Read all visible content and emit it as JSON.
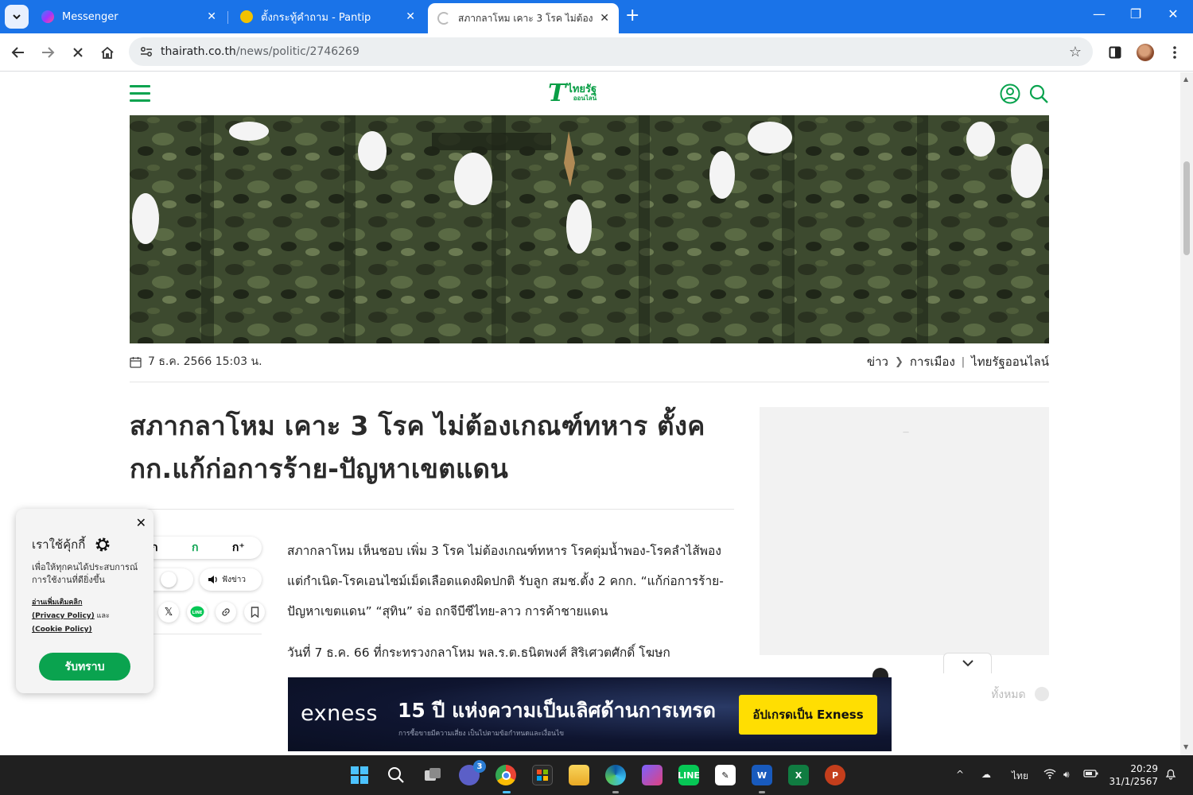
{
  "browser": {
    "tabs": [
      {
        "title": "Messenger",
        "favicon_color": "#a033ff"
      },
      {
        "title": "ตั้งกระทู้คำถาม - Pantip",
        "favicon_color": "#f2c200"
      },
      {
        "title": "สภากลาโหม เคาะ 3 โรค ไม่ต้องเกณฑ์ทหาร ตั้งค กก.แก้ก่อการร้าย-ปัญหาเขตแดน",
        "favicon_color": "#bbbbbb",
        "active": true
      }
    ],
    "close_glyph": "✕",
    "new_tab_glyph": "+",
    "url_host": "thairath.co.th",
    "url_path": "/news/politic/2746269"
  },
  "site": {
    "logo_letter": "T",
    "logo_name": "ไทยรัฐ",
    "logo_sub": "ออนไลน์",
    "brand_color": "#0aa34f"
  },
  "article": {
    "date": "7 ธ.ค. 2566 15:03 น.",
    "breadcrumbs": [
      "ข่าว",
      "การเมือง"
    ],
    "source": "ไทยรัฐออนไลน์",
    "headline": "สภากลาโหม เคาะ 3 โรค ไม่ต้องเกณฑ์ทหาร ตั้งค กก.แก้ก่อการร้าย-ปัญหาเขตแดน",
    "paragraphs": [
      "สภากลาโหม เห็นชอบ เพิ่ม 3 โรค ไม่ต้องเกณฑ์ทหาร โรคตุ่มน้ำพอง-โรคลำไส้พองแต่กำเนิด-โรคเอนไซม์เม็ดเลือดแดงผิดปกติ รับลูก สมช.ตั้ง 2 คกก. “แก้ก่อการร้าย-ปัญหาเขตแดน” “สุทิน” จ่อ ถกจีบีซีไทย-ลาว การค้าชายแดน",
      "วันที่ 7 ธ.ค. 66 ที่กระทรวงกลาโหม พล.ร.ต.ธนิตพงศ์ สิริเศวตศักดิ์ โฆษก"
    ]
  },
  "tools": {
    "font_small": "-ก",
    "font_mid": "ก",
    "font_large": "ก⁺",
    "light_label": "ight",
    "listen_label": "ฟังข่าว"
  },
  "sidebar": {
    "see_all": "ทั้งหมด"
  },
  "ad": {
    "logo": "exness",
    "headline": "15 ปี แห่งความเป็นเลิศด้านการเทรด",
    "disclaimer": "การซื้อขายมีความเสี่ยง เป็นไปตามข้อกำหนดและเงื่อนไข",
    "cta": "อัปเกรดเป็น Exness"
  },
  "cookie": {
    "title": "เราใช้คุ้กกี้",
    "desc": "เพื่อให้ทุกคนได้ประสบการณ์การใช้งานที่ดียิ่งขึ้น",
    "read_more": "อ่านเพิ่มเติมคลิก",
    "privacy": "(Privacy Policy)",
    "and": " และ",
    "cookie_policy": "(Cookie Policy)",
    "accept": "รับทราบ"
  },
  "taskbar": {
    "chat_badge": "3",
    "lang": "ไทย",
    "time": "20:29",
    "date": "31/1/2567"
  }
}
